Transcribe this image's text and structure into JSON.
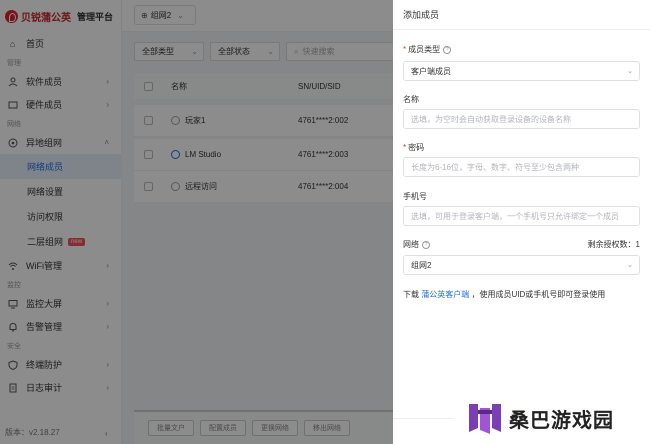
{
  "brand": {
    "name": "贝锐蒲公英",
    "sub": "管理平台"
  },
  "sidebar": {
    "home": "首页",
    "group_manage": "管理",
    "software_members": "软件成员",
    "hardware_members": "硬件成员",
    "group_network": "网络",
    "remote_network": "异地组网",
    "sub_items": [
      "网络成员",
      "网络设置",
      "访问权限"
    ],
    "l2_network": "二层组网",
    "new_badge": "new",
    "wifi": "WiFi管理",
    "group_monitor": "监控",
    "monitor_screen": "监控大屏",
    "alarm": "告警管理",
    "group_security": "安全",
    "terminal_protect": "终端防护",
    "log_audit": "日志审计",
    "version": "版本：v2.18.27"
  },
  "topbar": {
    "network": "组网2"
  },
  "filters": {
    "type": "全部类型",
    "status": "全部状态",
    "search_placeholder": "快速搜索"
  },
  "table": {
    "headers": {
      "name": "名称",
      "sn": "SN/UID/SID"
    },
    "rows": [
      {
        "name": "玩家1",
        "sn": "4761****2:002"
      },
      {
        "name": "LM Studio",
        "sn": "4761****2:003"
      },
      {
        "name": "远程访问",
        "sn": "4761****2:004"
      }
    ]
  },
  "bottom_buttons": [
    "批量文户",
    "配置成员",
    "更换网络",
    "移出网络"
  ],
  "drawer": {
    "title": "添加成员",
    "member_type_label": "成员类型",
    "member_type_value": "客户端成员",
    "name_label": "名称",
    "name_placeholder": "选填，为空时会自动获取登录设备的设备名称",
    "password_label": "密码",
    "password_placeholder": "长度为6-16位，字母、数字、符号至少包含两种",
    "phone_label": "手机号",
    "phone_placeholder": "选填，可用于登录客户端，一个手机号只允许绑定一个成员",
    "network_label": "网络",
    "remaining_auth": "剩余授权数：1",
    "network_value": "组网2",
    "download_prefix": "下载",
    "download_link": "蒲公英客户端",
    "download_suffix": "，使用成员UID或手机号即可登录使用"
  },
  "watermark": {
    "text": "桑巴游戏园"
  },
  "colors": {
    "accent": "#1f6fe8",
    "brand_red": "#c8262b",
    "required": "#e53935",
    "watermark_purple": "#7b3fb5"
  }
}
